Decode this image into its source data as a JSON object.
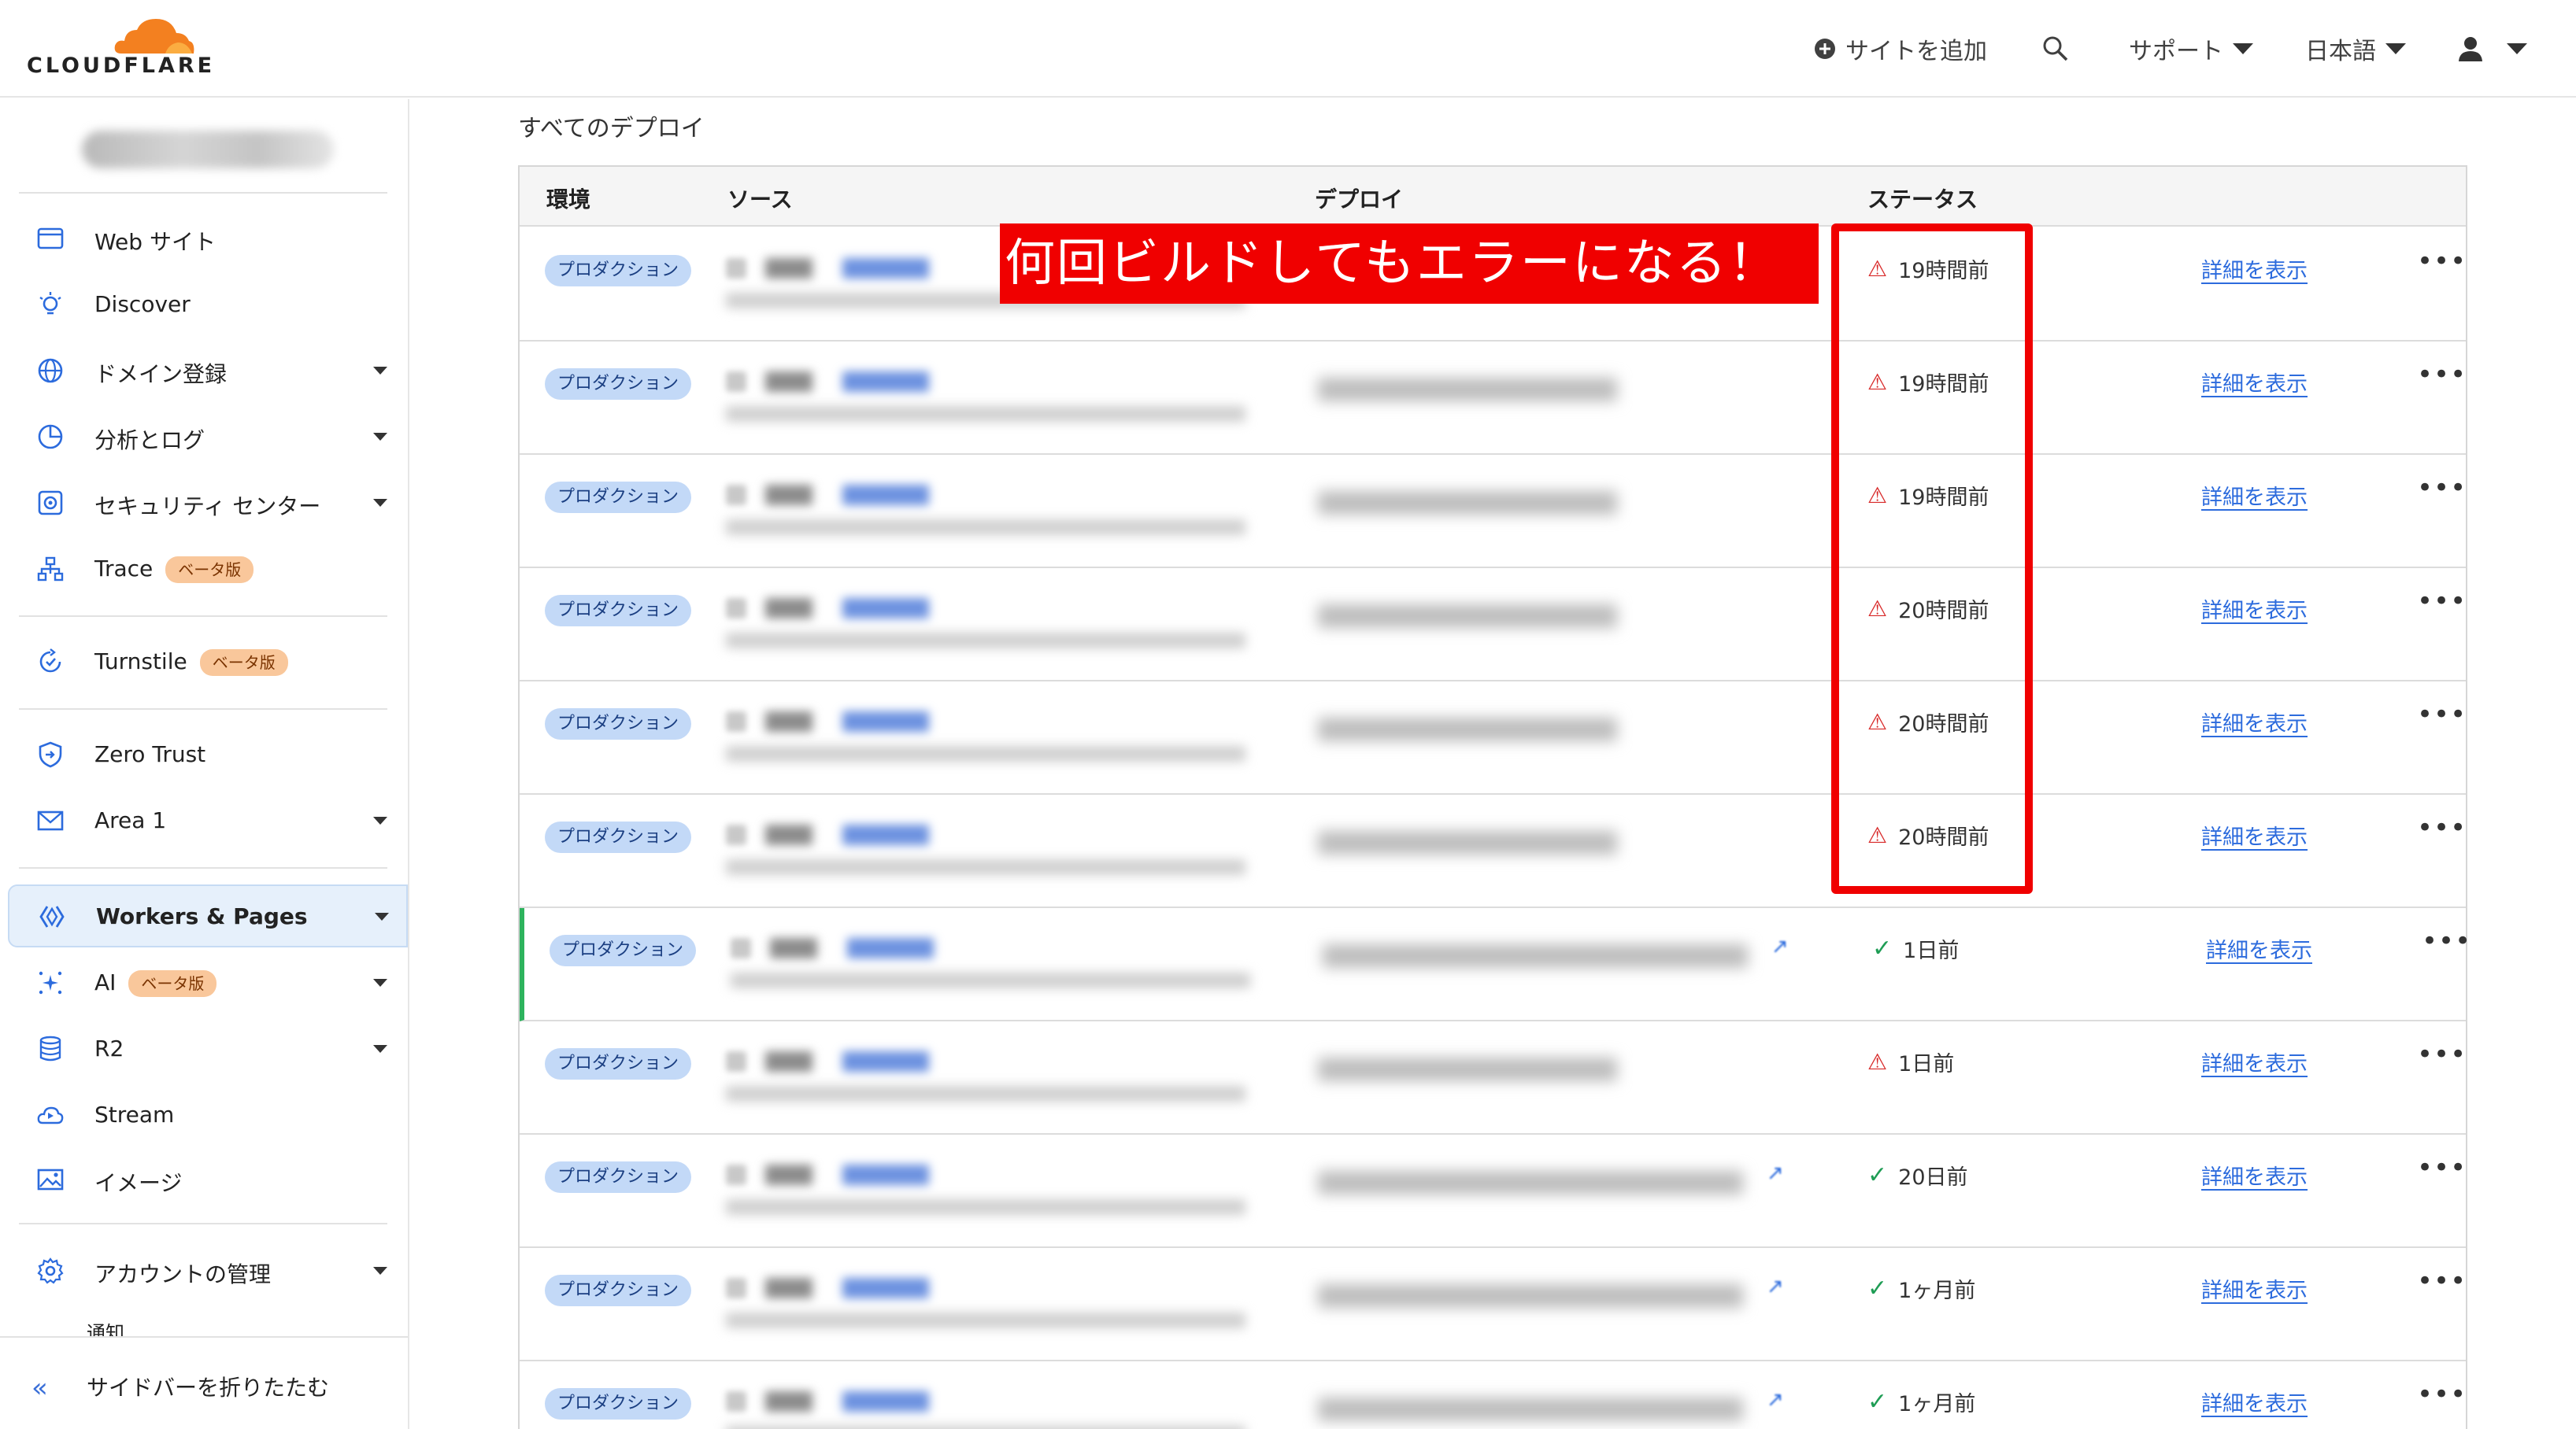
{
  "brand": {
    "logo_text": "CLOUDFLARE",
    "accent": "#F38020"
  },
  "topbar": {
    "add_site": "サイトを追加",
    "support": "サポート",
    "language": "日本語"
  },
  "sidebar": {
    "items": [
      {
        "label": "Web サイト",
        "icon": "browser-window-icon"
      },
      {
        "label": "Discover",
        "icon": "lightbulb-icon"
      },
      {
        "label": "ドメイン登録",
        "icon": "globe-icon",
        "expandable": true
      },
      {
        "label": "分析とログ",
        "icon": "pie-chart-icon",
        "expandable": true
      },
      {
        "label": "セキュリティ センター",
        "icon": "security-center-icon",
        "expandable": true
      },
      {
        "label": "Trace",
        "icon": "hierarchy-icon",
        "badge": "ベータ版"
      },
      {
        "label": "Turnstile",
        "icon": "turnstile-icon",
        "badge": "ベータ版"
      },
      {
        "label": "Zero Trust",
        "icon": "zero-trust-shield-icon"
      },
      {
        "label": "Area 1",
        "icon": "envelope-icon",
        "expandable": true
      },
      {
        "label": "Workers & Pages",
        "icon": "workers-icon",
        "expandable": true,
        "active": true
      },
      {
        "label": "AI",
        "icon": "ai-sparkle-icon",
        "badge": "ベータ版",
        "expandable": true
      },
      {
        "label": "R2",
        "icon": "database-icon",
        "expandable": true
      },
      {
        "label": "Stream",
        "icon": "cloud-play-icon"
      },
      {
        "label": "イメージ",
        "icon": "image-icon"
      },
      {
        "label": "アカウントの管理",
        "icon": "gear-icon",
        "expandable": true
      }
    ],
    "partial_item": "通知",
    "collapse_label": "サイドバーを折りたたむ"
  },
  "main": {
    "title": "すべてのデプロイ",
    "columns": {
      "env": "環境",
      "source": "ソース",
      "deploy": "デプロイ",
      "status": "ステータス"
    },
    "env_label": "プロダクション",
    "details_label": "詳細を表示",
    "rows": [
      {
        "status": "error",
        "time": "19時間前"
      },
      {
        "status": "error",
        "time": "19時間前"
      },
      {
        "status": "error",
        "time": "19時間前"
      },
      {
        "status": "error",
        "time": "20時間前"
      },
      {
        "status": "error",
        "time": "20時間前"
      },
      {
        "status": "error",
        "time": "20時間前"
      },
      {
        "status": "success",
        "time": "1日前",
        "current": true,
        "link": true
      },
      {
        "status": "error",
        "time": "1日前"
      },
      {
        "status": "success",
        "time": "20日前",
        "link": true
      },
      {
        "status": "success",
        "time": "1ヶ月前",
        "link": true
      },
      {
        "status": "success",
        "time": "1ヶ月前",
        "link": true
      }
    ]
  },
  "annotation": {
    "callout_text": "何回ビルドしてもエラーになる！",
    "color": "#F00000"
  }
}
